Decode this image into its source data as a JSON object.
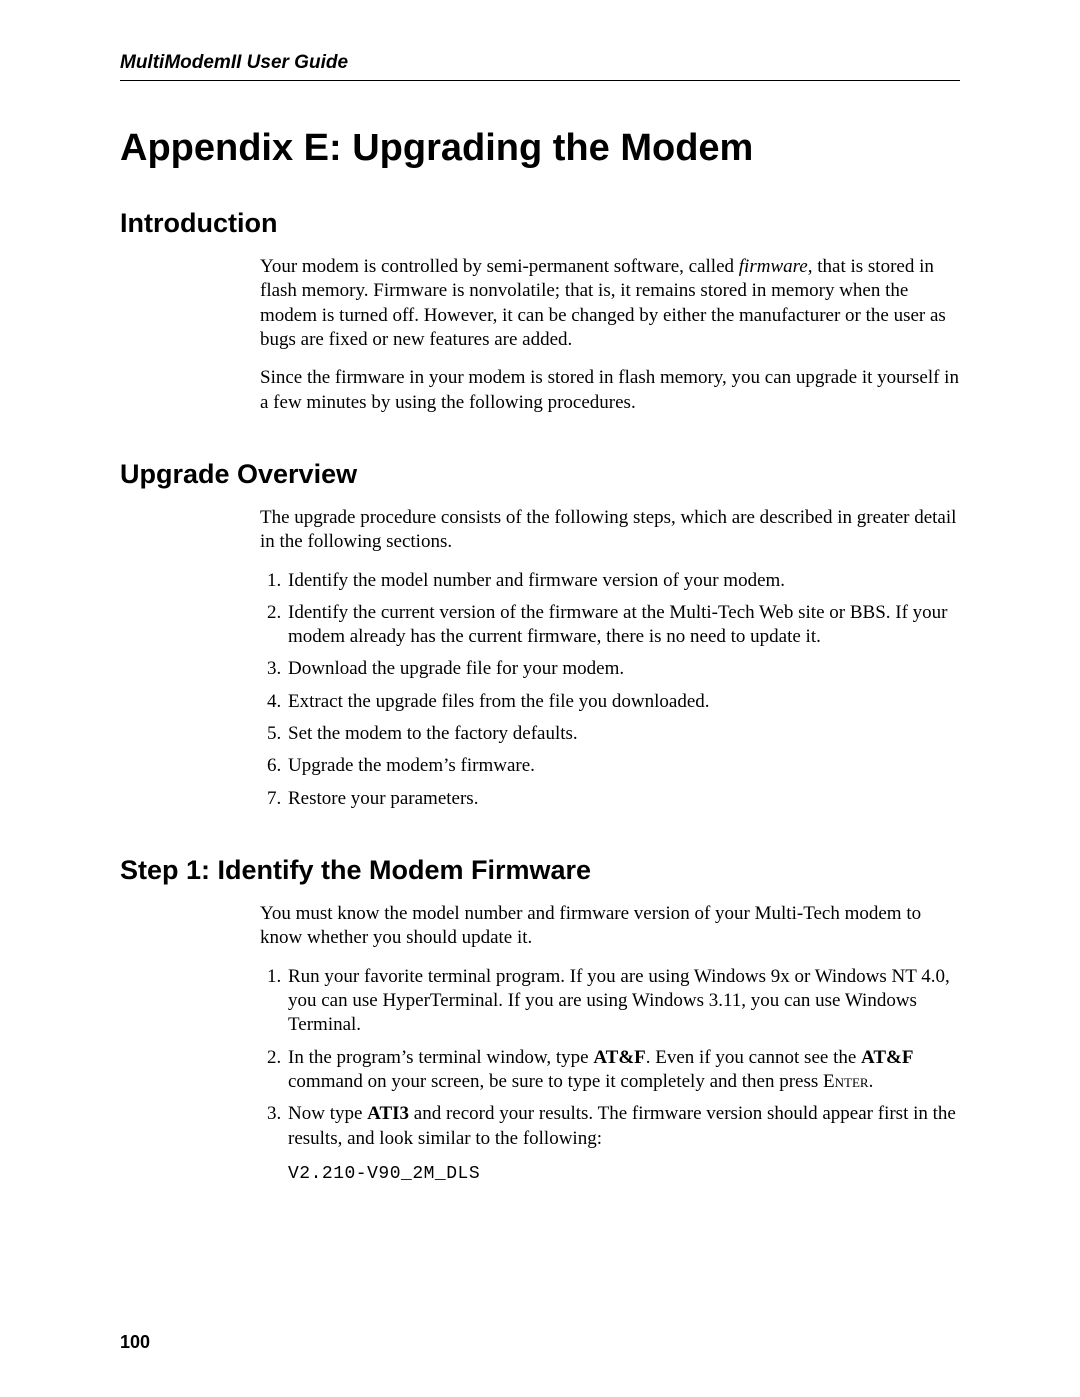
{
  "header": {
    "running_title": "MultiModemII User Guide"
  },
  "title": "Appendix E: Upgrading the Modem",
  "sections": {
    "intro": {
      "heading": "Introduction",
      "p1_a": "Your modem is controlled by semi-permanent software, called ",
      "p1_firmware": "firmware",
      "p1_b": ", that is stored in flash memory. Firmware is nonvolatile; that is, it remains stored in memory when the modem is turned off. However, it can be changed by either the manufacturer or the user as bugs are fixed or new features are added.",
      "p2": "Since the firmware in your modem is stored in flash memory, you can upgrade it yourself in a few minutes by using the following procedures."
    },
    "overview": {
      "heading": "Upgrade Overview",
      "p1": "The upgrade procedure consists of the following steps, which are described in greater detail in the following sections.",
      "steps": [
        "Identify the model number and firmware version of your modem.",
        "Identify the current version of the firmware at the Multi-Tech Web site or BBS. If your modem already has the current firmware, there is no need to update it.",
        "Download the upgrade file for your modem.",
        "Extract the upgrade files from the file you downloaded.",
        "Set the modem to the factory defaults.",
        "Upgrade the modem’s firmware.",
        "Restore your parameters."
      ]
    },
    "step1": {
      "heading": "Step 1: Identify the Modem Firmware",
      "p1": "You must know the model number and firmware version of your Multi-Tech modem to know whether you should update it.",
      "li1": "Run your favorite terminal program. If you are using Windows 9x or Windows NT 4.0, you can use HyperTerminal. If you are using Windows 3.11, you can use Windows Terminal.",
      "li2_a": "In the program’s terminal window, type ",
      "li2_cmd1": "AT&F",
      "li2_b": ". Even if you cannot see the ",
      "li2_cmd2": "AT&F",
      "li2_c": " command on your screen, be sure to type it completely and then press ",
      "li2_enter": "Enter",
      "li2_d": ".",
      "li3_a": "Now type ",
      "li3_cmd": "ATI3",
      "li3_b": " and record your results. The firmware version should appear first in the results, and look similar to the following:",
      "example": "V2.210-V90_2M_DLS"
    }
  },
  "page_number": "100"
}
